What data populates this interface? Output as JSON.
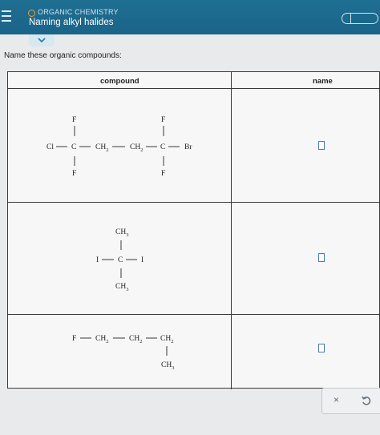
{
  "header": {
    "course": "ORGANIC CHEMISTRY",
    "topic": "Naming alkyl halides"
  },
  "instruction": "Name these organic compounds:",
  "table": {
    "col_compound": "compound",
    "col_name": "name"
  },
  "molecules": {
    "m1": {
      "top_f1": "F",
      "top_f2": "F",
      "cl": "Cl",
      "c1": "C",
      "ch2a": "CH",
      "sub2a": "2",
      "ch2b": "CH",
      "sub2b": "2",
      "c2": "C",
      "br": "Br",
      "bot_f1": "F",
      "bot_f2": "F"
    },
    "m2": {
      "ch3_top": "CH",
      "sub3_top": "3",
      "i_left": "I",
      "c": "C",
      "i_right": "I",
      "ch3_bot": "CH",
      "sub3_bot": "3"
    },
    "m3": {
      "f": "F",
      "ch2a": "CH",
      "sub2a": "2",
      "ch2b": "CH",
      "sub2b": "2",
      "ch2c": "CH",
      "sub2c": "2",
      "ch3": "CH",
      "sub3": "3"
    }
  },
  "actions": {
    "clear": "×"
  }
}
